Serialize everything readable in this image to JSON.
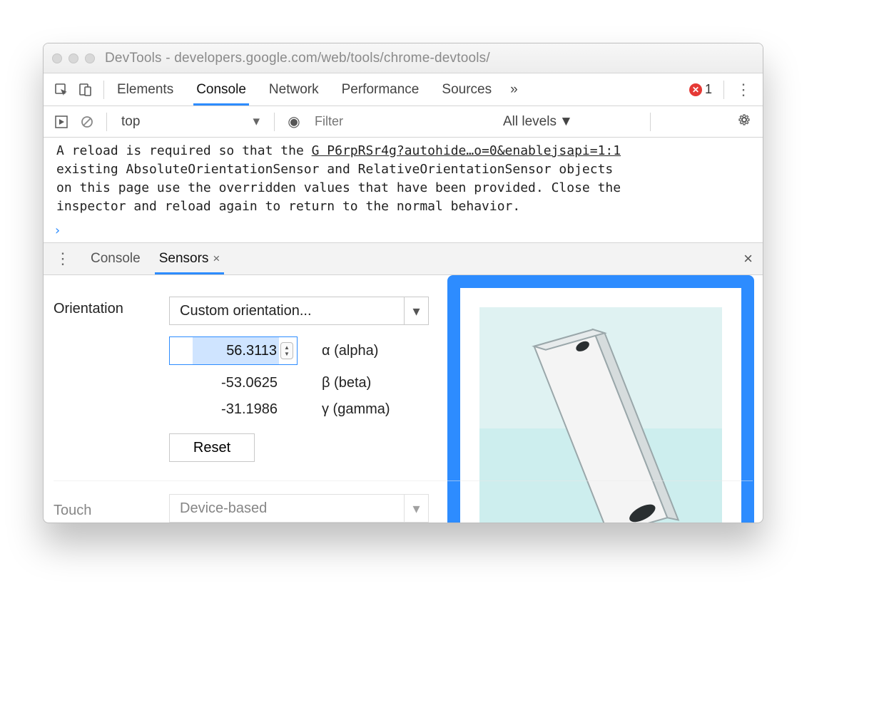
{
  "window": {
    "title": "DevTools - developers.google.com/web/tools/chrome-devtools/"
  },
  "mainTabs": {
    "items": [
      "Elements",
      "Console",
      "Network",
      "Performance",
      "Sources"
    ],
    "activeIndex": 1,
    "overflow": "»",
    "errorCount": "1"
  },
  "consoleBar": {
    "context": "top",
    "filterPlaceholder": "Filter",
    "levels": "All levels"
  },
  "consoleMsg": {
    "textL1a": "A reload is required so that the ",
    "source": "G P6rpRSr4g?autohide…o=0&enablejsapi=1:1",
    "textL2": "existing AbsoluteOrientationSensor and RelativeOrientationSensor objects",
    "textL3": "on this page use the overridden values that have been provided. Close the",
    "textL4": "inspector and reload again to return to the normal behavior."
  },
  "drawer": {
    "tabs": [
      "Console",
      "Sensors"
    ],
    "activeIndex": 1
  },
  "orientation": {
    "label": "Orientation",
    "preset": "Custom orientation...",
    "alpha": "56.3113",
    "alphaLabel": "α (alpha)",
    "beta": "-53.0625",
    "betaLabel": "β (beta)",
    "gamma": "-31.1986",
    "gammaLabel": "γ (gamma)",
    "reset": "Reset"
  },
  "touch": {
    "label": "Touch",
    "value": "Device-based"
  }
}
